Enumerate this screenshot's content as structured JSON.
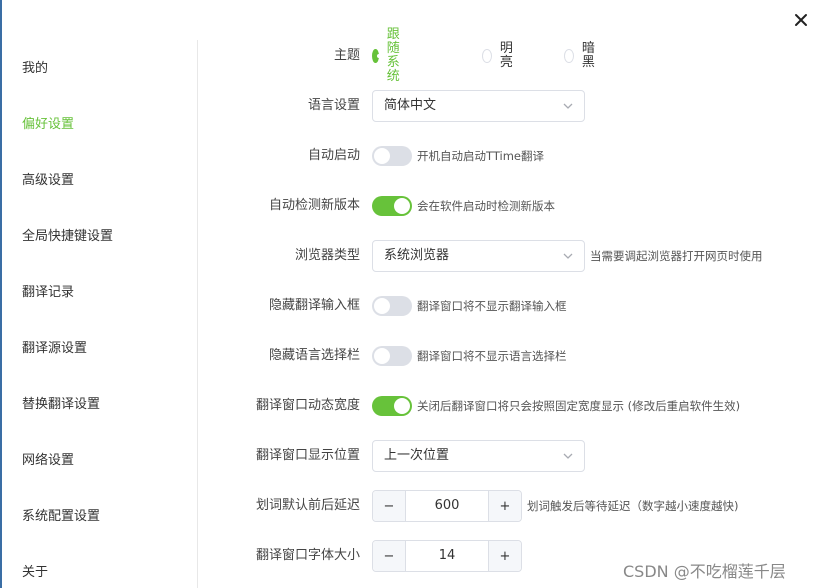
{
  "dialog": {
    "close_label": "✕"
  },
  "sidebar": {
    "items": [
      {
        "label": "我的",
        "active": false
      },
      {
        "label": "偏好设置",
        "active": true
      },
      {
        "label": "高级设置",
        "active": false
      },
      {
        "label": "全局快捷键设置",
        "active": false
      },
      {
        "label": "翻译记录",
        "active": false
      },
      {
        "label": "翻译源设置",
        "active": false
      },
      {
        "label": "替换翻译设置",
        "active": false
      },
      {
        "label": "网络设置",
        "active": false
      },
      {
        "label": "系统配置设置",
        "active": false
      },
      {
        "label": "关于",
        "active": false
      }
    ]
  },
  "settings": {
    "theme": {
      "label": "主题",
      "options": [
        {
          "label": "跟随系统",
          "selected": true
        },
        {
          "label": "明亮",
          "selected": false
        },
        {
          "label": "暗黑",
          "selected": false
        }
      ]
    },
    "language": {
      "label": "语言设置",
      "value": "简体中文"
    },
    "autostart": {
      "label": "自动启动",
      "enabled": false,
      "hint": "开机自动启动TTime翻译"
    },
    "update_check": {
      "label": "自动检测新版本",
      "enabled": true,
      "hint": "会在软件启动时检测新版本"
    },
    "browser": {
      "label": "浏览器类型",
      "value": "系统浏览器",
      "hint": "当需要调起浏览器打开网页时使用"
    },
    "hide_input": {
      "label": "隐藏翻译输入框",
      "enabled": false,
      "hint": "翻译窗口将不显示翻译输入框"
    },
    "hide_lang_bar": {
      "label": "隐藏语言选择栏",
      "enabled": false,
      "hint": "翻译窗口将不显示语言选择栏"
    },
    "dynamic_width": {
      "label": "翻译窗口动态宽度",
      "enabled": true,
      "hint": "关闭后翻译窗口将只会按照固定宽度显示 (修改后重启软件生效)"
    },
    "window_position": {
      "label": "翻译窗口显示位置",
      "value": "上一次位置"
    },
    "select_delay": {
      "label": "划词默认前后延迟",
      "value": "600",
      "hint": "划词触发后等待延迟（数字越小速度越快)"
    },
    "font_size": {
      "label": "翻译窗口字体大小",
      "value": "14"
    }
  },
  "stepper_symbols": {
    "minus": "−",
    "plus": "+"
  },
  "watermark": "CSDN @不吃榴莲千层",
  "colors": {
    "accent": "#67c23a",
    "border": "#dcdfe6",
    "switch_off": "#dcdfe6"
  }
}
